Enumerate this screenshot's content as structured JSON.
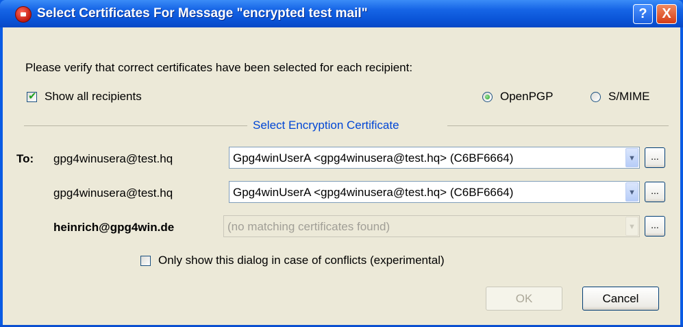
{
  "window": {
    "title": "Select Certificates For Message \"encrypted test mail\"",
    "help_label": "?",
    "close_label": "X"
  },
  "instruction": "Please verify that correct certificates have been selected for each recipient:",
  "show_all": {
    "label": "Show all recipients",
    "checked": true
  },
  "protocol": {
    "options": [
      {
        "label": "OpenPGP",
        "selected": true
      },
      {
        "label": "S/MIME",
        "selected": false
      }
    ]
  },
  "group_title": "Select Encryption Certificate",
  "recipients": [
    {
      "prefix": "To:",
      "email": "gpg4winusera@test.hq",
      "certificate": "Gpg4winUserA <gpg4winusera@test.hq> (C6BF6664)",
      "enabled": true,
      "bold": false
    },
    {
      "prefix": "",
      "email": "gpg4winusera@test.hq",
      "certificate": "Gpg4winUserA <gpg4winusera@test.hq> (C6BF6664)",
      "enabled": true,
      "bold": false
    },
    {
      "prefix": "",
      "email": "heinrich@gpg4win.de",
      "certificate": "(no matching certificates found)",
      "enabled": false,
      "bold": true
    }
  ],
  "browse_label": "...",
  "conflicts_only": {
    "label": "Only show this dialog in case of conflicts (experimental)",
    "checked": false
  },
  "buttons": {
    "ok": "OK",
    "cancel": "Cancel"
  },
  "colors": {
    "title_bar": "#0b55d8",
    "dialog_bg": "#ece9d8",
    "group_title": "#0046d5",
    "check_mark": "#21a121"
  }
}
